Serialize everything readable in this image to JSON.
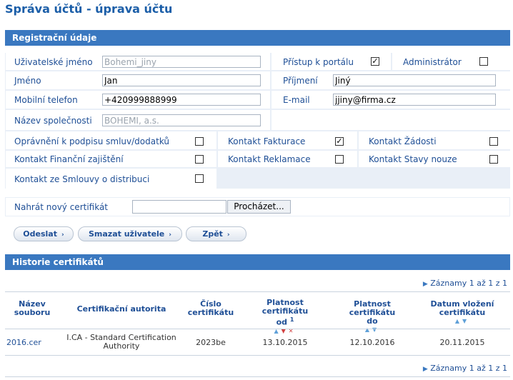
{
  "page_title": "Správa účtů - úprava účtu",
  "registration": {
    "header": "Registrační údaje",
    "username_label": "Uživatelské jméno",
    "username_value": "Bohemi_jiny",
    "portal_access_label": "Přístup k portálu",
    "portal_access_checked": "✓",
    "admin_label": "Administrátor",
    "firstname_label": "Jméno",
    "firstname_value": "Jan",
    "lastname_label": "Příjmení",
    "lastname_value": "Jiný",
    "phone_label": "Mobilní telefon",
    "phone_value": "+420999888999",
    "email_label": "E-mail",
    "email_value": "jjiny@firma.cz",
    "company_label": "Název společnosti",
    "company_value": "BOHEMI, a.s.",
    "sign_label": "Oprávnění k podpisu smluv/dodatků",
    "billing_label": "Kontakt Fakturace",
    "billing_checked": "✓",
    "requests_label": "Kontakt Žádosti",
    "financial_label": "Kontakt Finanční zajištění",
    "complaints_label": "Kontakt Reklamace",
    "emergency_label": "Kontakt Stavy nouze",
    "distribution_label": "Kontakt ze Smlouvy o distribuci"
  },
  "upload": {
    "label": "Nahrát nový certifikát",
    "browse_label": "Procházet..."
  },
  "actions": {
    "send": "Odeslat",
    "delete_user": "Smazat uživatele",
    "back": "Zpět"
  },
  "history": {
    "header": "Historie certifikátů",
    "pager_text": "Záznamy 1 až 1 z 1",
    "columns": {
      "file_l1": "Název",
      "file_l2": "souboru",
      "ca": "Certifikační autorita",
      "num_l1": "Číslo",
      "num_l2": "certifikátu",
      "from_l1": "Platnost certifikátu",
      "from_l2": "od",
      "from_sup": "1",
      "to_l1": "Platnost certifikátu",
      "to_l2": "do",
      "inserted_l1": "Datum vložení",
      "inserted_l2": "certifikátu"
    },
    "row": {
      "file": "2016.cer",
      "ca_l1": "I.CA - Standard Certification",
      "ca_l2": "Authority",
      "number": "2023be",
      "valid_from": "13.10.2015",
      "valid_to": "12.10.2016",
      "inserted": "20.11.2015"
    }
  }
}
